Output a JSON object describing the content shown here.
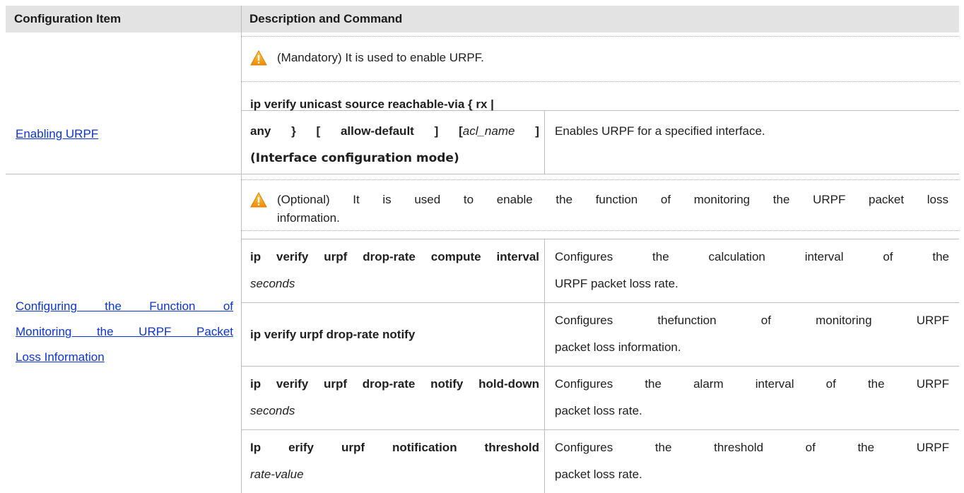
{
  "header": {
    "col1": "Configuration Item",
    "col2": "Description and Command"
  },
  "rows": [
    {
      "item": "Enabling URPF",
      "note": "(Mandatory) It is used to enable URPF.",
      "commands": [
        {
          "cmd_line1": "ip verify unicast source reachable-via { rx |",
          "cmd_line2_a": "any",
          "cmd_line2_b": "}",
          "cmd_line2_c": "[",
          "cmd_line2_d": "allow-default",
          "cmd_line2_e": "]",
          "cmd_line2_f": "[",
          "cmd_line2_arg": "acl_name",
          "cmd_line2_g": "]",
          "cmd_line3": "(Interface configuration mode)",
          "desc": "Enables URPF for a specified interface."
        }
      ]
    },
    {
      "item_line1": "Configuring the Function of",
      "item_line2": "Monitoring the URPF Packet",
      "item_line3": "Loss Information",
      "note_line1": "(Optional) It is used to enable the function of monitoring the URPF packet loss",
      "note_line2": "information.",
      "commands": [
        {
          "cmd": "ip verify urpf drop-rate compute interval",
          "arg": "seconds",
          "desc_line1": "Configures the calculation interval of the",
          "desc_line2": "URPF packet loss rate."
        },
        {
          "cmd": "ip verify urpf drop-rate notify",
          "desc_line1": "Configures thefunction of monitoring URPF",
          "desc_line2": "packet loss information."
        },
        {
          "cmd": "ip verify urpf drop-rate notify hold-down",
          "arg": "seconds",
          "desc_line1": "Configures the alarm interval of the URPF",
          "desc_line2": "packet loss rate."
        },
        {
          "cmd": "Ip erify urpf notification threshold",
          "arg": "rate-value",
          "desc_line1": "Configures the threshold of the URPF",
          "desc_line2": "packet loss rate."
        }
      ]
    }
  ]
}
